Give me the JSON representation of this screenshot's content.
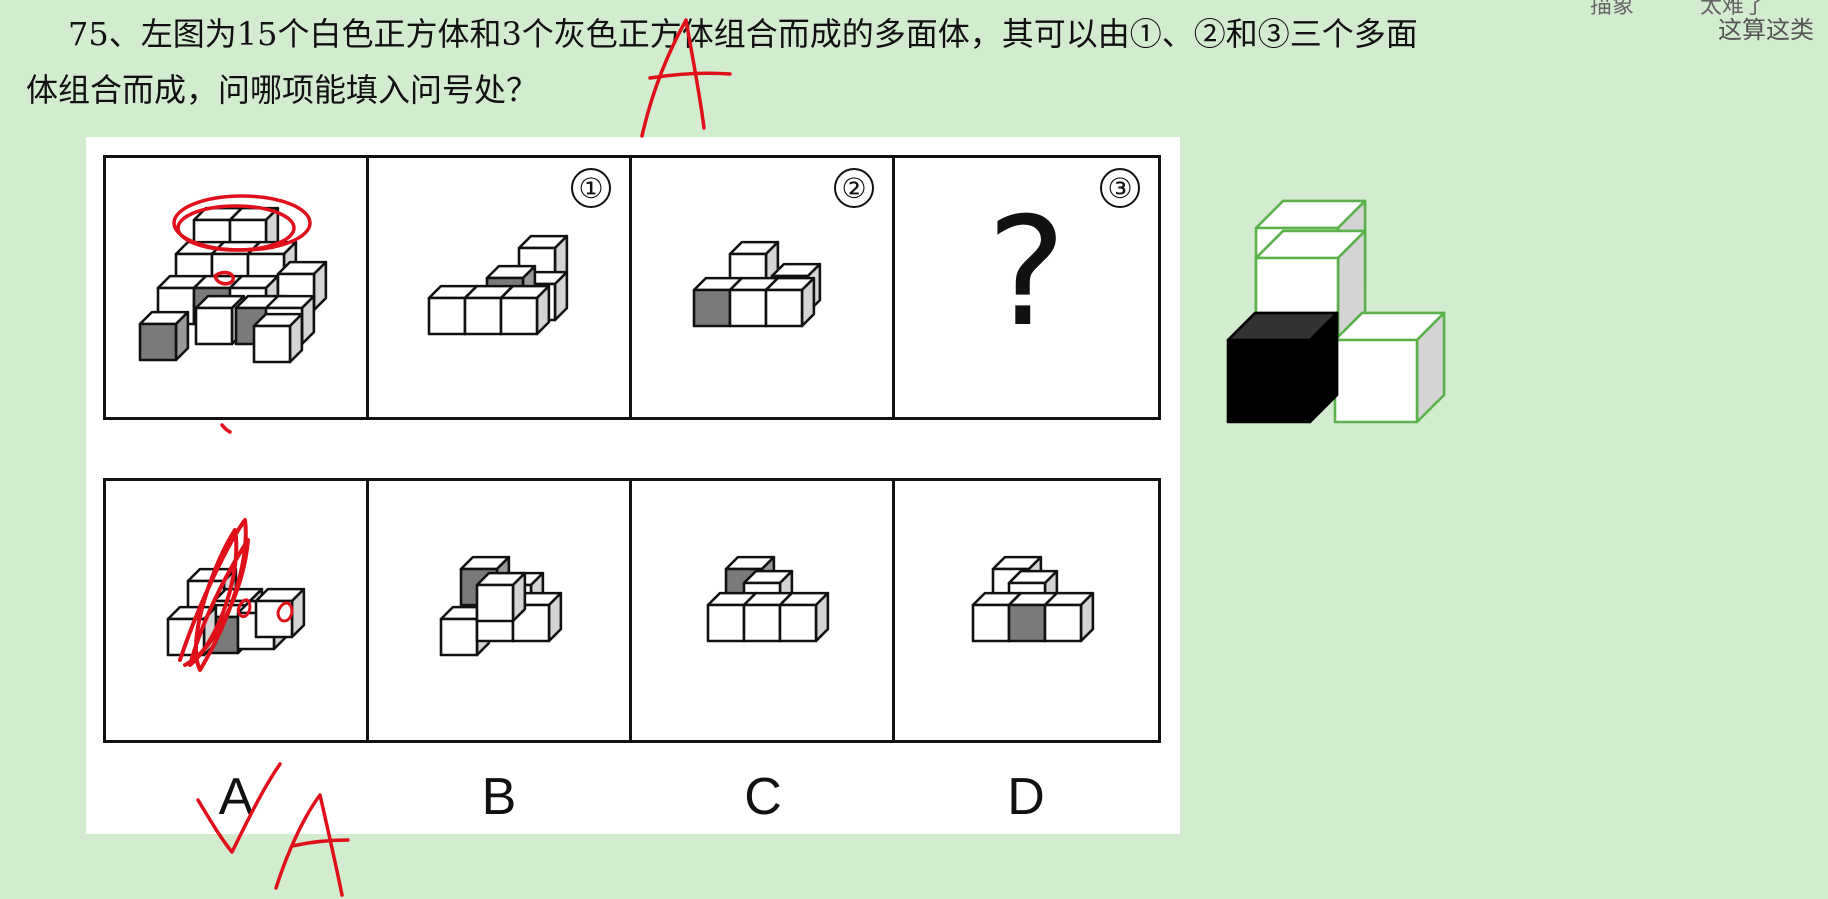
{
  "question": {
    "line1": "75、左图为15个白色正方体和3个灰色正方体组合而成的多面体，其可以由①、②和③三个多面",
    "line2": "体组合而成，问哪项能填入问号处？"
  },
  "corner_overlay": {
    "text_a": "描象",
    "text_b": "太难了",
    "text_c": "这算这类"
  },
  "top_row": {
    "labels": [
      "①",
      "②",
      "③"
    ],
    "unknown_symbol": "?"
  },
  "options": [
    "A",
    "B",
    "C",
    "D"
  ],
  "annotations": {
    "handwritten_answer_top": "A",
    "handwritten_answer_bottom": "A",
    "ink_color": "#e0101a"
  },
  "colors": {
    "background": "#d3ecd0",
    "gray_cube": "#7a7a7a",
    "black_cube": "#000000",
    "outline_green": "#5bb14a"
  }
}
